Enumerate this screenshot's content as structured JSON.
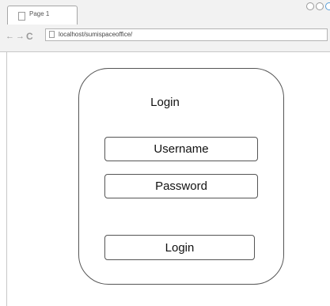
{
  "browser": {
    "tab_title": "Page 1",
    "url": "localhost/sumispaceoffice/",
    "nav": {
      "back_icon": "←",
      "forward_icon": "→",
      "reload_icon": "C"
    }
  },
  "login": {
    "title": "Login",
    "username_label": "Username",
    "password_label": "Password",
    "submit_label": "Login"
  }
}
